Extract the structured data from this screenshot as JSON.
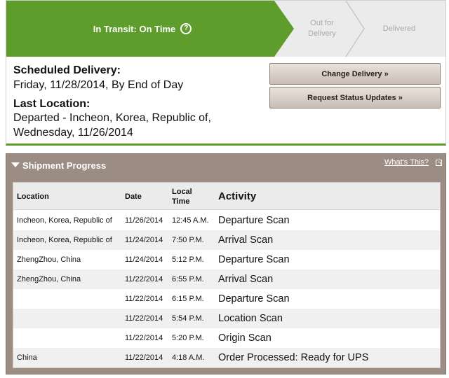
{
  "status": {
    "steps": [
      {
        "label": "In Transit: On Time",
        "active": true
      },
      {
        "label": "Out for Delivery",
        "active": false
      },
      {
        "label": "Delivered",
        "active": false
      }
    ],
    "scheduled_label": "Scheduled Delivery:",
    "scheduled_value": "Friday, 11/28/2014, By End of Day",
    "last_location_label": "Last Location:",
    "last_location_value": "Departed - Incheon, Korea, Republic of, Wednesday, 11/26/2014",
    "buttons": {
      "change_delivery": "Change Delivery »",
      "request_updates": "Request Status Updates »"
    }
  },
  "shipment_progress": {
    "title": "Shipment Progress",
    "whats_this": "What's This?",
    "columns": {
      "location": "Location",
      "date": "Date",
      "time": "Local Time",
      "activity": "Activity"
    },
    "rows": [
      {
        "location": "Incheon, Korea, Republic of",
        "date": "11/26/2014",
        "time": "12:45 A.M.",
        "activity": "Departure Scan"
      },
      {
        "location": "Incheon, Korea, Republic of",
        "date": "11/24/2014",
        "time": "7:50 P.M.",
        "activity": "Arrival Scan"
      },
      {
        "location": "ZhengZhou, China",
        "date": "11/24/2014",
        "time": "5:12 P.M.",
        "activity": "Departure Scan"
      },
      {
        "location": "ZhengZhou, China",
        "date": "11/22/2014",
        "time": "6:55 P.M.",
        "activity": "Arrival Scan"
      },
      {
        "location": "",
        "date": "11/22/2014",
        "time": "6:15 P.M.",
        "activity": "Departure Scan"
      },
      {
        "location": "",
        "date": "11/22/2014",
        "time": "5:54 P.M.",
        "activity": "Location Scan"
      },
      {
        "location": "",
        "date": "11/22/2014",
        "time": "5:20 P.M.",
        "activity": "Origin Scan"
      },
      {
        "location": "China",
        "date": "11/22/2014",
        "time": "4:18 A.M.",
        "activity": "Order Processed: Ready for UPS"
      }
    ]
  },
  "colors": {
    "active_step": "#5e9c2c",
    "inactive_step": "#ebebeb",
    "panel_brown": "#9b8d84",
    "button_gradient_top": "#e8e2dd",
    "button_gradient_bottom": "#c8bdb5"
  }
}
